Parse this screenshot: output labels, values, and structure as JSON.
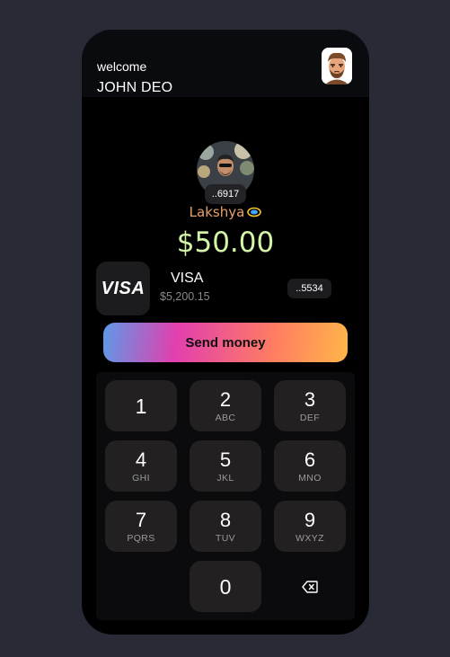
{
  "header": {
    "welcome": "welcome",
    "username": "JOHN DEO"
  },
  "recipient": {
    "account_suffix": "..6917",
    "name": "Lakshya"
  },
  "amount": "$50.00",
  "card": {
    "brand": "VISA",
    "balance": "$5,200.15",
    "suffix": "..5534",
    "logo_text": "VISA"
  },
  "send_button": "Send money",
  "keypad": [
    {
      "digit": "1",
      "letters": ""
    },
    {
      "digit": "2",
      "letters": "ABC"
    },
    {
      "digit": "3",
      "letters": "DEF"
    },
    {
      "digit": "4",
      "letters": "GHI"
    },
    {
      "digit": "5",
      "letters": "JKL"
    },
    {
      "digit": "6",
      "letters": "MNO"
    },
    {
      "digit": "7",
      "letters": "PQRS"
    },
    {
      "digit": "8",
      "letters": "TUV"
    },
    {
      "digit": "9",
      "letters": "WXYZ"
    },
    {
      "digit": "0",
      "letters": ""
    }
  ],
  "icons": {
    "backspace": "backspace-icon",
    "verified": "verified-badge-icon",
    "avatar": "memoji-avatar",
    "recipient_photo": "recipient-photo"
  },
  "colors": {
    "amount": "#d4f5a8",
    "recipient_name": "#e8a06a",
    "background": "#282a36",
    "key": "#232022"
  }
}
